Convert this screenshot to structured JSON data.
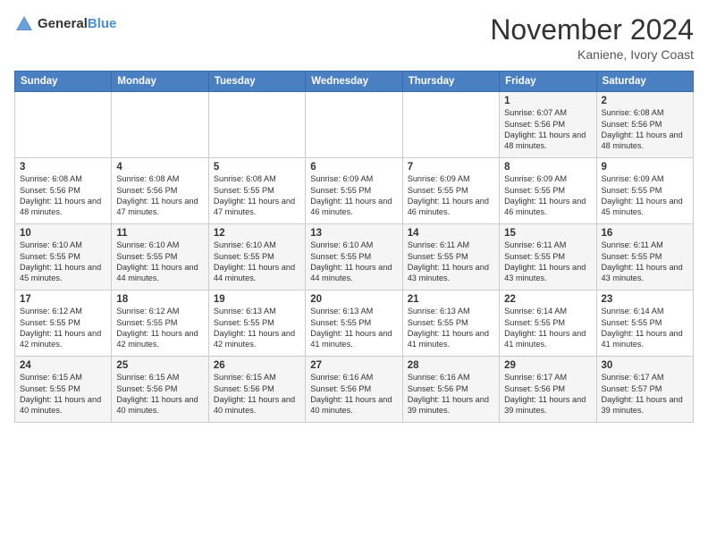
{
  "header": {
    "logo_general": "General",
    "logo_blue": "Blue",
    "month": "November 2024",
    "location": "Kaniene, Ivory Coast"
  },
  "calendar": {
    "days_of_week": [
      "Sunday",
      "Monday",
      "Tuesday",
      "Wednesday",
      "Thursday",
      "Friday",
      "Saturday"
    ],
    "weeks": [
      [
        {
          "day": "",
          "info": ""
        },
        {
          "day": "",
          "info": ""
        },
        {
          "day": "",
          "info": ""
        },
        {
          "day": "",
          "info": ""
        },
        {
          "day": "",
          "info": ""
        },
        {
          "day": "1",
          "info": "Sunrise: 6:07 AM\nSunset: 5:56 PM\nDaylight: 11 hours and 48 minutes."
        },
        {
          "day": "2",
          "info": "Sunrise: 6:08 AM\nSunset: 5:56 PM\nDaylight: 11 hours and 48 minutes."
        }
      ],
      [
        {
          "day": "3",
          "info": "Sunrise: 6:08 AM\nSunset: 5:56 PM\nDaylight: 11 hours and 48 minutes."
        },
        {
          "day": "4",
          "info": "Sunrise: 6:08 AM\nSunset: 5:56 PM\nDaylight: 11 hours and 47 minutes."
        },
        {
          "day": "5",
          "info": "Sunrise: 6:08 AM\nSunset: 5:55 PM\nDaylight: 11 hours and 47 minutes."
        },
        {
          "day": "6",
          "info": "Sunrise: 6:09 AM\nSunset: 5:55 PM\nDaylight: 11 hours and 46 minutes."
        },
        {
          "day": "7",
          "info": "Sunrise: 6:09 AM\nSunset: 5:55 PM\nDaylight: 11 hours and 46 minutes."
        },
        {
          "day": "8",
          "info": "Sunrise: 6:09 AM\nSunset: 5:55 PM\nDaylight: 11 hours and 46 minutes."
        },
        {
          "day": "9",
          "info": "Sunrise: 6:09 AM\nSunset: 5:55 PM\nDaylight: 11 hours and 45 minutes."
        }
      ],
      [
        {
          "day": "10",
          "info": "Sunrise: 6:10 AM\nSunset: 5:55 PM\nDaylight: 11 hours and 45 minutes."
        },
        {
          "day": "11",
          "info": "Sunrise: 6:10 AM\nSunset: 5:55 PM\nDaylight: 11 hours and 44 minutes."
        },
        {
          "day": "12",
          "info": "Sunrise: 6:10 AM\nSunset: 5:55 PM\nDaylight: 11 hours and 44 minutes."
        },
        {
          "day": "13",
          "info": "Sunrise: 6:10 AM\nSunset: 5:55 PM\nDaylight: 11 hours and 44 minutes."
        },
        {
          "day": "14",
          "info": "Sunrise: 6:11 AM\nSunset: 5:55 PM\nDaylight: 11 hours and 43 minutes."
        },
        {
          "day": "15",
          "info": "Sunrise: 6:11 AM\nSunset: 5:55 PM\nDaylight: 11 hours and 43 minutes."
        },
        {
          "day": "16",
          "info": "Sunrise: 6:11 AM\nSunset: 5:55 PM\nDaylight: 11 hours and 43 minutes."
        }
      ],
      [
        {
          "day": "17",
          "info": "Sunrise: 6:12 AM\nSunset: 5:55 PM\nDaylight: 11 hours and 42 minutes."
        },
        {
          "day": "18",
          "info": "Sunrise: 6:12 AM\nSunset: 5:55 PM\nDaylight: 11 hours and 42 minutes."
        },
        {
          "day": "19",
          "info": "Sunrise: 6:13 AM\nSunset: 5:55 PM\nDaylight: 11 hours and 42 minutes."
        },
        {
          "day": "20",
          "info": "Sunrise: 6:13 AM\nSunset: 5:55 PM\nDaylight: 11 hours and 41 minutes."
        },
        {
          "day": "21",
          "info": "Sunrise: 6:13 AM\nSunset: 5:55 PM\nDaylight: 11 hours and 41 minutes."
        },
        {
          "day": "22",
          "info": "Sunrise: 6:14 AM\nSunset: 5:55 PM\nDaylight: 11 hours and 41 minutes."
        },
        {
          "day": "23",
          "info": "Sunrise: 6:14 AM\nSunset: 5:55 PM\nDaylight: 11 hours and 41 minutes."
        }
      ],
      [
        {
          "day": "24",
          "info": "Sunrise: 6:15 AM\nSunset: 5:55 PM\nDaylight: 11 hours and 40 minutes."
        },
        {
          "day": "25",
          "info": "Sunrise: 6:15 AM\nSunset: 5:56 PM\nDaylight: 11 hours and 40 minutes."
        },
        {
          "day": "26",
          "info": "Sunrise: 6:15 AM\nSunset: 5:56 PM\nDaylight: 11 hours and 40 minutes."
        },
        {
          "day": "27",
          "info": "Sunrise: 6:16 AM\nSunset: 5:56 PM\nDaylight: 11 hours and 40 minutes."
        },
        {
          "day": "28",
          "info": "Sunrise: 6:16 AM\nSunset: 5:56 PM\nDaylight: 11 hours and 39 minutes."
        },
        {
          "day": "29",
          "info": "Sunrise: 6:17 AM\nSunset: 5:56 PM\nDaylight: 11 hours and 39 minutes."
        },
        {
          "day": "30",
          "info": "Sunrise: 6:17 AM\nSunset: 5:57 PM\nDaylight: 11 hours and 39 minutes."
        }
      ]
    ]
  }
}
